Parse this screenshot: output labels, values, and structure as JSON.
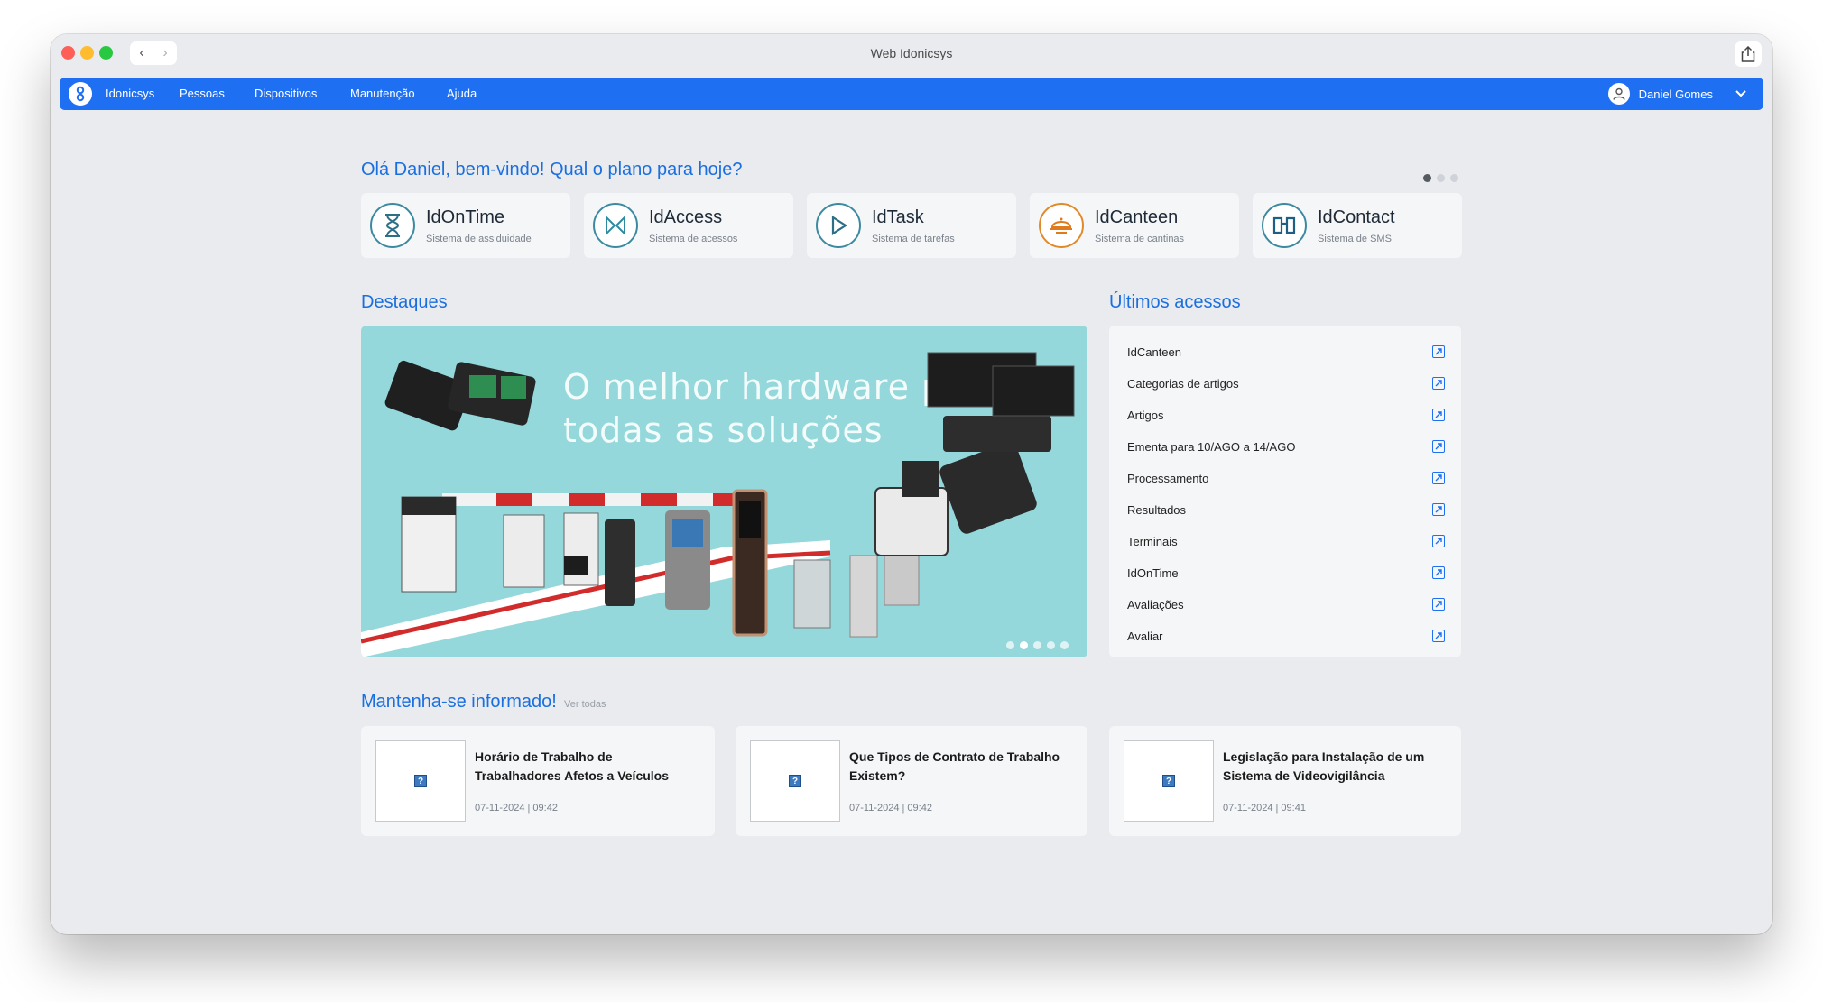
{
  "window": {
    "title": "Web Idonicsys"
  },
  "nav": {
    "items": [
      "Idonicsys",
      "Pessoas",
      "Dispositivos",
      "Manutenção",
      "Ajuda"
    ],
    "user_name": "Daniel Gomes"
  },
  "greeting": "Olá Daniel, bem-vindo! Qual o plano para hoje?",
  "apps": [
    {
      "name": "IdOnTime",
      "subtitle": "Sistema de assiduidade",
      "icon": "hourglass-icon"
    },
    {
      "name": "IdAccess",
      "subtitle": "Sistema de acessos",
      "icon": "access-icon"
    },
    {
      "name": "IdTask",
      "subtitle": "Sistema de tarefas",
      "icon": "play-icon"
    },
    {
      "name": "IdCanteen",
      "subtitle": "Sistema de cantinas",
      "icon": "canteen-icon"
    },
    {
      "name": "IdContact",
      "subtitle": "Sistema de SMS",
      "icon": "book-icon"
    }
  ],
  "highlights": {
    "title": "Destaques",
    "banner_text_line1": "O melhor hardware para",
    "banner_text_line2": "todas as soluções"
  },
  "recent": {
    "title": "Últimos acessos",
    "items": [
      "IdCanteen",
      "Categorias de artigos",
      "Artigos",
      "Ementa para 10/AGO a 14/AGO",
      "Processamento",
      "Resultados",
      "Terminais",
      "IdOnTime",
      "Avaliações",
      "Avaliar"
    ]
  },
  "news": {
    "title": "Mantenha-se informado!",
    "see_all": "Ver todas",
    "items": [
      {
        "title": "Horário de Trabalho de Trabalhadores Afetos a Veículos",
        "date": "07-11-2024 | 09:42"
      },
      {
        "title": "Que Tipos de Contrato de Trabalho Existem?",
        "date": "07-11-2024 | 09:42"
      },
      {
        "title": "Legislação para Instalação de um Sistema de Videovigilância",
        "date": "07-11-2024 | 09:41"
      }
    ]
  },
  "colors": {
    "primary": "#1f6ff2",
    "heading": "#1a6fe0",
    "banner": "#94d8db"
  }
}
